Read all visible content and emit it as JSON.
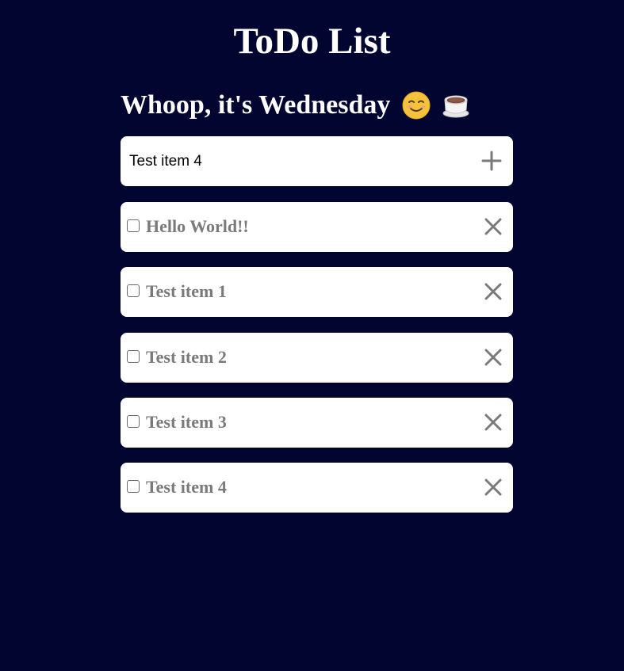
{
  "header": {
    "title": "ToDo List",
    "greeting": "Whoop, it's Wednesday"
  },
  "greeting_emojis": [
    {
      "name": "smiling-face-icon",
      "color": "#f5c33b"
    },
    {
      "name": "hot-beverage-icon",
      "color": "#7a4a3a"
    }
  ],
  "new_item": {
    "value": "Test item 4",
    "add_icon": "plus-icon"
  },
  "todos": [
    {
      "text": "Hello World!!",
      "checked": false
    },
    {
      "text": "Test item 1",
      "checked": false
    },
    {
      "text": "Test item 2",
      "checked": false
    },
    {
      "text": "Test item 3",
      "checked": false
    },
    {
      "text": "Test item 4",
      "checked": false
    }
  ],
  "colors": {
    "background": "#02052f",
    "card": "#ffffff",
    "item_text": "#7a7a7a",
    "icon": "#7a7a7a"
  }
}
